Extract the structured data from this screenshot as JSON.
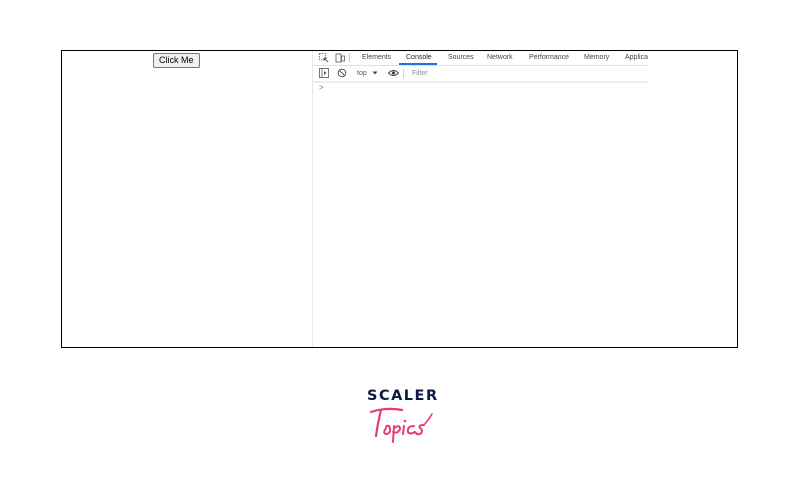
{
  "page": {
    "button_label": "Click Me"
  },
  "devtools": {
    "tabs": [
      "Elements",
      "Console",
      "Sources",
      "Network",
      "Performance",
      "Memory",
      "Applica"
    ],
    "active_tab": "Console",
    "icons": [
      "inspect-element-icon",
      "device-toolbar-icon"
    ],
    "toolbar": {
      "sidebar_icon": "sidebar-toggle-icon",
      "clear_icon": "clear-console-icon",
      "context_value": "top",
      "eye_icon": "live-expression-icon",
      "filter_placeholder": "Filter"
    },
    "prompt_symbol": ">"
  },
  "branding": {
    "logo_text_top": "SCALER",
    "logo_text_bottom": "Topics",
    "colors": {
      "navy": "#0b1b3f",
      "pink": "#e8397a"
    }
  }
}
